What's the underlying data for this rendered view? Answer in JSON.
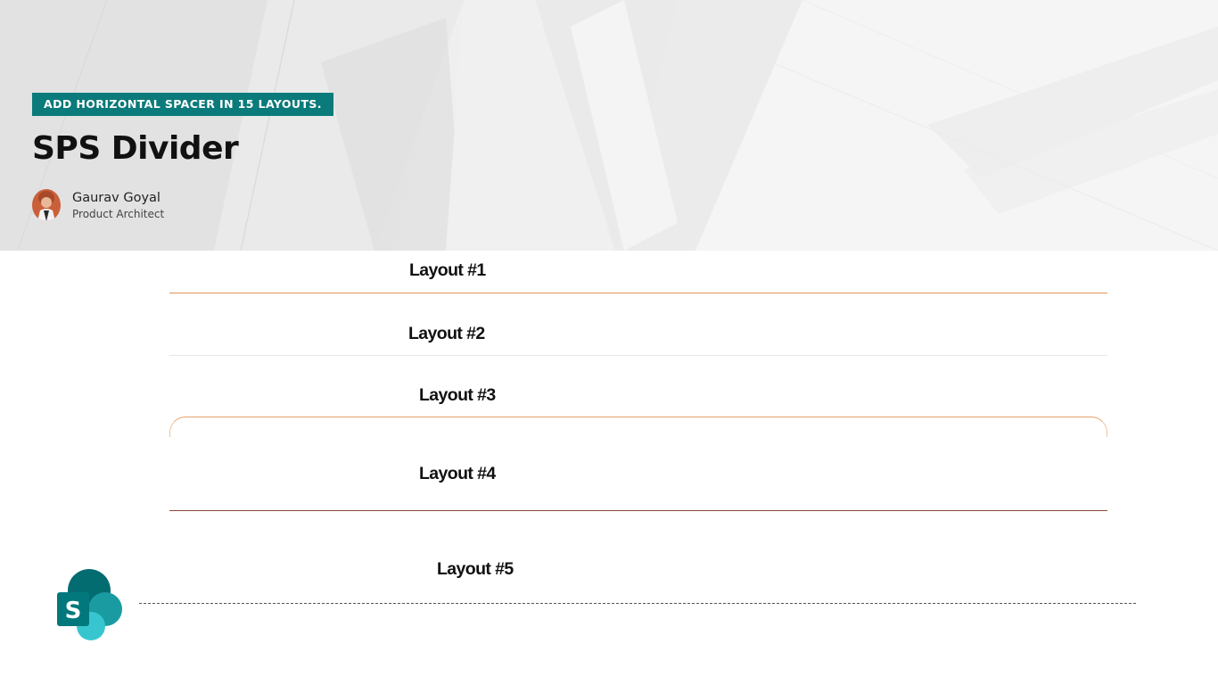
{
  "hero": {
    "tagline": "ADD HORIZONTAL SPACER IN 15 LAYOUTS.",
    "title": "SPS Divider",
    "author": {
      "name": "Gaurav Goyal",
      "role": "Product Architect"
    },
    "tagline_color": "#0b7a7a"
  },
  "layouts": [
    {
      "title": "Layout #1",
      "divider_color": "#e0955a"
    },
    {
      "title": "Layout #2",
      "divider_color": "#e6e6e6"
    },
    {
      "title": "Layout #3",
      "divider_color": "#e6a06a"
    },
    {
      "title": "Layout #4",
      "divider_color": "#8a4a3a"
    },
    {
      "title": "Layout #5",
      "divider_color": "#555555"
    }
  ],
  "logo": {
    "letter": "S",
    "icon": "sharepoint-logo-icon",
    "colors": [
      "#036c70",
      "#1a9ba1",
      "#37c6d0"
    ]
  }
}
